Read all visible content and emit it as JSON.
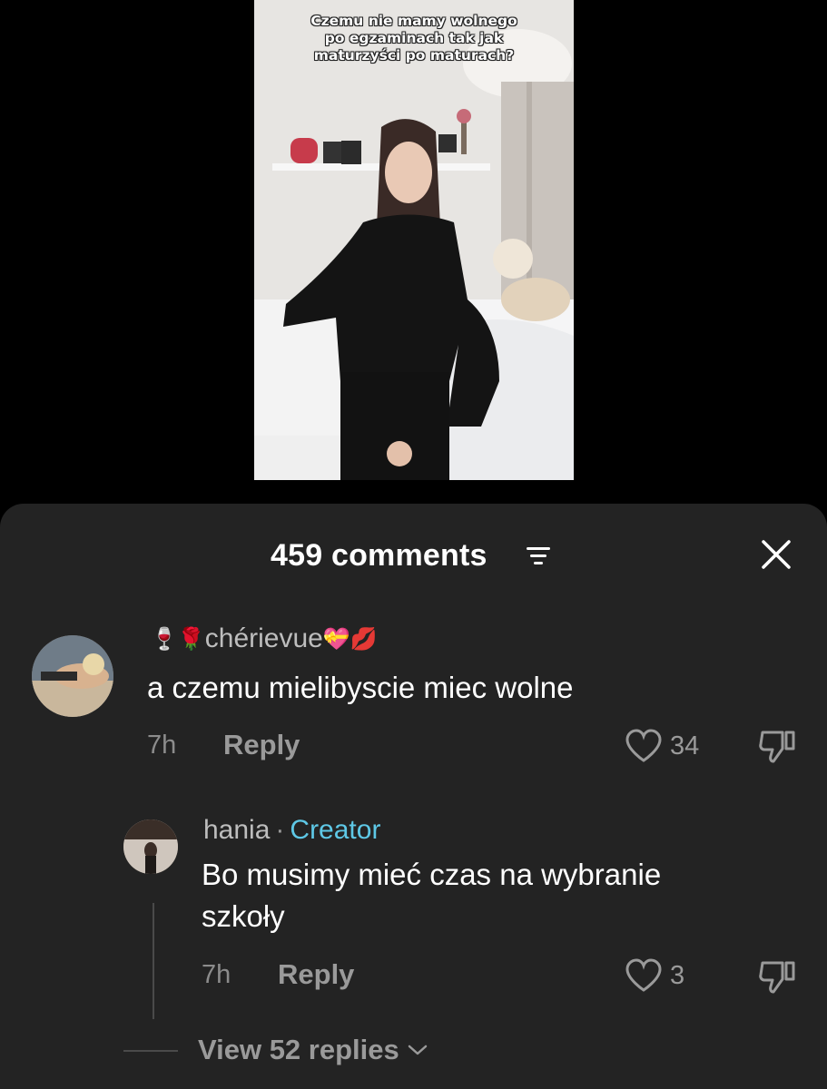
{
  "video": {
    "caption_lines": [
      "Czemu nie mamy wolnego",
      "po egzaminach tak jak",
      "maturzyści po maturach?"
    ]
  },
  "sheet": {
    "comments_count": "459 comments",
    "filter_icon": "filter-icon",
    "close_icon": "close-icon"
  },
  "comments": [
    {
      "emoji_prefix": "🍷🌹",
      "username": "chérievue",
      "emoji_suffix": "💝💋",
      "text": "a czemu mielibyscie miec wolne",
      "time": "7h",
      "reply_label": "Reply",
      "likes": "34"
    },
    {
      "username": "hania",
      "separator": "·",
      "badge": "Creator",
      "text_lines": [
        "Bo musimy mieć czas na wybranie",
        "szkoły"
      ],
      "time": "7h",
      "reply_label": "Reply",
      "likes": "3"
    }
  ],
  "view_replies": "View 52 replies",
  "colors": {
    "sheet_background": "#232323",
    "creator_badge": "#5ec8e6",
    "muted_text": "#9a9a9a"
  }
}
